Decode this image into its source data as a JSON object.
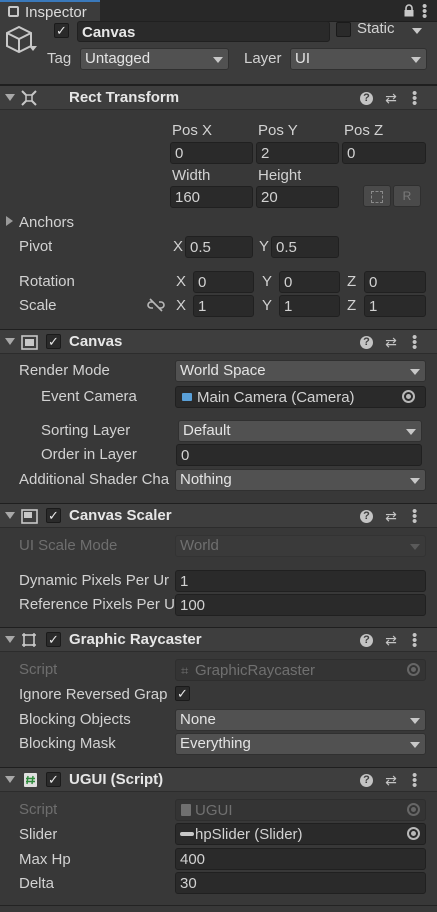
{
  "window": {
    "tab_title": "Inspector"
  },
  "gameobject": {
    "active": true,
    "name": "Canvas",
    "static_label": "Static",
    "tag_label": "Tag",
    "tag_value": "Untagged",
    "layer_label": "Layer",
    "layer_value": "UI"
  },
  "rect_transform": {
    "title": "Rect Transform",
    "pos_x_label": "Pos X",
    "pos_y_label": "Pos Y",
    "pos_z_label": "Pos Z",
    "pos_x": "0",
    "pos_y": "2",
    "pos_z": "0",
    "width_label": "Width",
    "height_label": "Height",
    "width": "160",
    "height": "20",
    "raw_edit_label": "R",
    "anchors_label": "Anchors",
    "pivot_label": "Pivot",
    "pivot_x": "0.5",
    "pivot_y": "0.5",
    "rotation_label": "Rotation",
    "rot_x": "0",
    "rot_y": "0",
    "rot_z": "0",
    "scale_label": "Scale",
    "scale_x": "1",
    "scale_y": "1",
    "scale_z": "1",
    "axis_x": "X",
    "axis_y": "Y",
    "axis_z": "Z"
  },
  "canvas": {
    "title": "Canvas",
    "enabled": true,
    "render_mode_label": "Render Mode",
    "render_mode": "World Space",
    "event_camera_label": "Event Camera",
    "event_camera": "Main Camera (Camera)",
    "sorting_layer_label": "Sorting Layer",
    "sorting_layer": "Default",
    "order_label": "Order in Layer",
    "order": "0",
    "shader_channels_label": "Additional Shader Cha",
    "shader_channels": "Nothing"
  },
  "canvas_scaler": {
    "title": "Canvas Scaler",
    "enabled": true,
    "ui_scale_mode_label": "UI Scale Mode",
    "ui_scale_mode": "World",
    "dynamic_ppu_label": "Dynamic Pixels Per Ur",
    "dynamic_ppu": "1",
    "reference_ppu_label": "Reference Pixels Per U",
    "reference_ppu": "100"
  },
  "graphic_raycaster": {
    "title": "Graphic Raycaster",
    "enabled": true,
    "script_label": "Script",
    "script": "GraphicRaycaster",
    "ignore_reversed_label": "Ignore Reversed Grap",
    "ignore_reversed": true,
    "blocking_objects_label": "Blocking Objects",
    "blocking_objects": "None",
    "blocking_mask_label": "Blocking Mask",
    "blocking_mask": "Everything"
  },
  "ugui_script": {
    "title": "UGUI (Script)",
    "enabled": true,
    "script_label": "Script",
    "script": "UGUI",
    "slider_label": "Slider",
    "slider": "hpSlider (Slider)",
    "max_hp_label": "Max Hp",
    "max_hp": "400",
    "delta_label": "Delta",
    "delta": "30"
  },
  "icons": {
    "tab": "inspector-icon",
    "lock": "lock-icon",
    "menu": "kebab-menu-icon",
    "help": "help-icon",
    "presets": "sliders-icon",
    "gameobject": "cube-icon"
  },
  "colors": {
    "accent": "#3a79bb",
    "background": "#383838",
    "header": "#3e3e3e",
    "field": "#2a2a2a"
  }
}
